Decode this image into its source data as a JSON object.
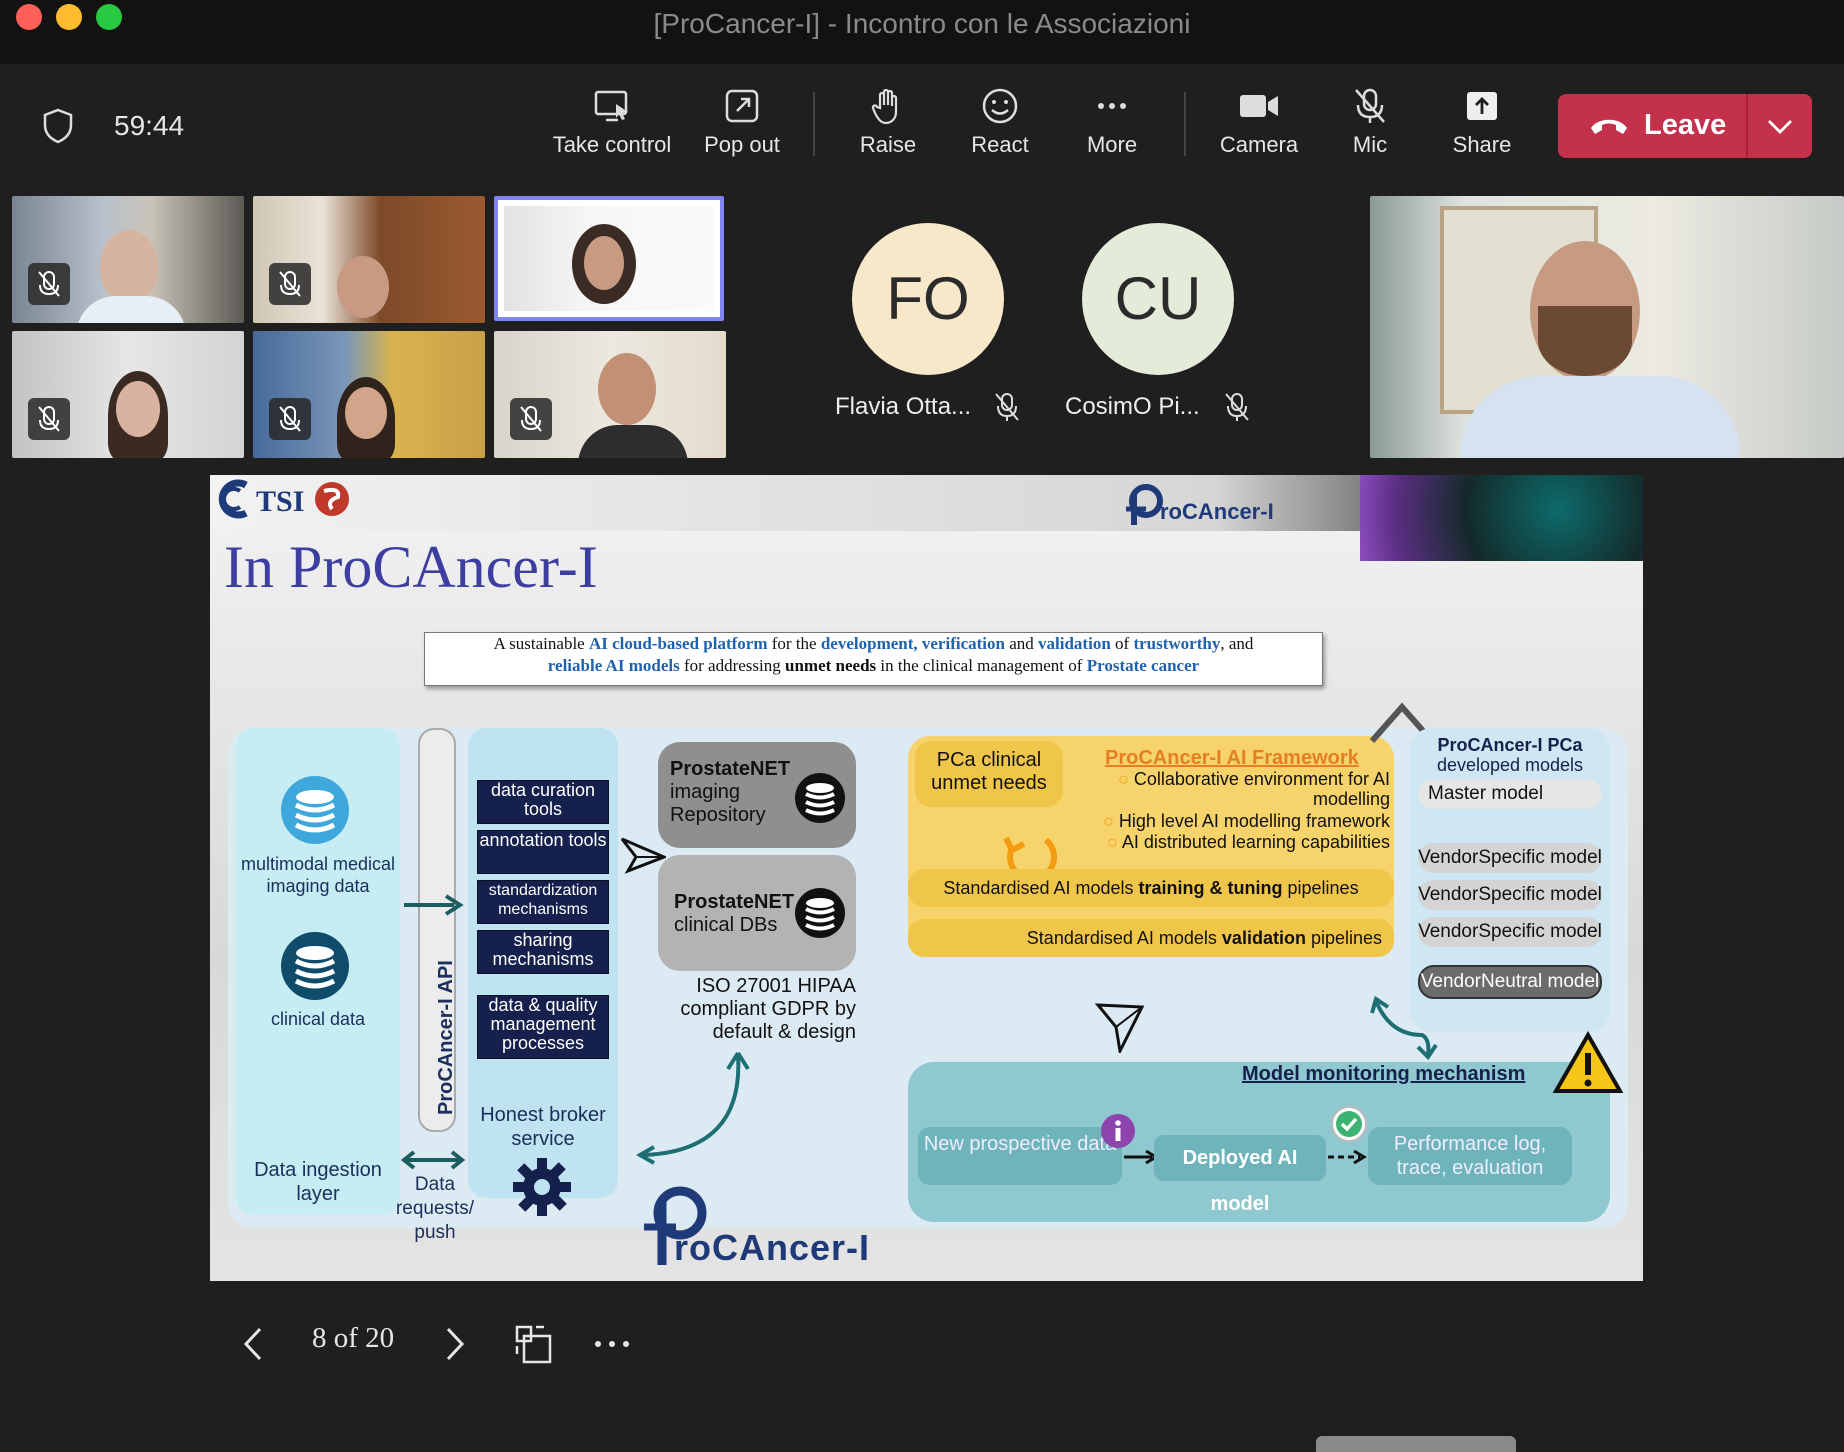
{
  "window": {
    "title": "[ProCancer-I] - Incontro con le Associazioni"
  },
  "meeting": {
    "timer": "59:44"
  },
  "toolbar": {
    "take_control": "Take control",
    "pop_out": "Pop out",
    "raise": "Raise",
    "react": "React",
    "more": "More",
    "camera": "Camera",
    "mic": "Mic",
    "share": "Share",
    "leave": "Leave"
  },
  "participants": {
    "avatars": [
      {
        "initials": "FO",
        "name": "Flavia Otta...",
        "color": "#f6e8c8"
      },
      {
        "initials": "CU",
        "name": "CosimO Pi...",
        "color": "#e4ecd9"
      }
    ]
  },
  "slide": {
    "title": "In ProCAncer-I",
    "logo_text": "roCAncer-I",
    "logo_initial": "P",
    "intro": {
      "p1": "A sustainable ",
      "b1": "AI cloud-based platform",
      "p2": " for the ",
      "b2": "development, verification",
      "p3": " and ",
      "b3": "validation",
      "p4": " of ",
      "b4": "trustworthy",
      "p5": ", and",
      "b5": "reliable AI models",
      "p6": " for addressing ",
      "k1": "unmet needs",
      "p7": " in the clinical management of ",
      "b6": "Prostate cancer"
    },
    "ingestion": {
      "imaging": "multimodal medical imaging data",
      "clinical": "clinical data",
      "layer": "Data ingestion layer",
      "api": "ProCAncer-I API",
      "requests": "Data requests/ push"
    },
    "tools": [
      "data curation tools",
      "annotation tools",
      "standardization mechanisms",
      "sharing mechanisms",
      "data & quality management processes"
    ],
    "honest_broker": "Honest broker service",
    "prostatenet_imaging": {
      "bold": "ProstateNET",
      "rest": "imaging Repository"
    },
    "prostatenet_clinical": {
      "bold": "ProstateNET",
      "rest": "clinical DBs"
    },
    "compliance": "ISO 27001 HIPAA compliant GDPR by default & design",
    "unmet_needs": "PCa clinical unmet needs",
    "framework": {
      "title": "ProCAncer-I AI Framework",
      "items": [
        "Collaborative environment for AI modelling",
        "High level AI modelling framework",
        "AI distributed learning capabilities"
      ]
    },
    "pipeline_training": {
      "p1": "Standardised AI models ",
      "b": "training & tuning",
      "p2": " pipelines"
    },
    "pipeline_validation": {
      "p1": "Standardised AI models ",
      "b": "validation",
      "p2": " pipelines"
    },
    "models": {
      "title_bold": "ProCAncer-I PCa",
      "title_rest": "developed models",
      "master": "Master model",
      "vendor": [
        "VendorSpecific model",
        "VendorSpecific model",
        "VendorSpecific model"
      ],
      "neutral": "VendorNeutral model"
    },
    "monitoring": {
      "title": "Model monitoring mechanism",
      "new_data": "New prospective data",
      "deployed": "Deployed AI model",
      "performance": "Performance log, trace, evaluation"
    }
  },
  "pager": {
    "label": "8 of 20"
  }
}
